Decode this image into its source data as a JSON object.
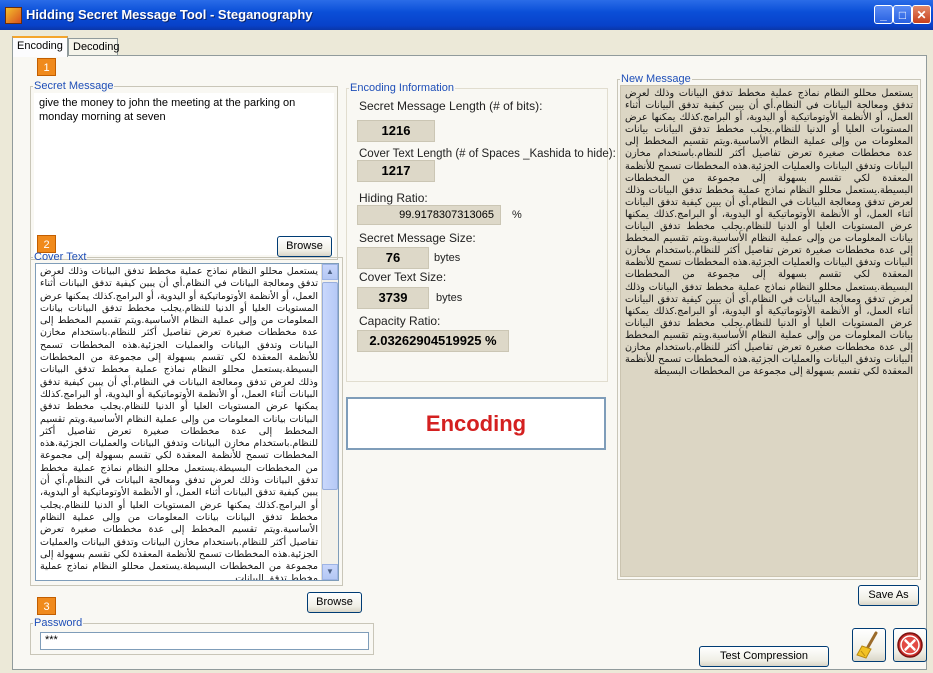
{
  "window": {
    "title": "Hidding Secret Message Tool - Steganography",
    "buttons": {
      "minimize": "_",
      "maximize": "□",
      "close": "✕"
    }
  },
  "tabs": [
    {
      "label": "Encoding",
      "active": true
    },
    {
      "label": "Decoding",
      "active": false
    }
  ],
  "steps": {
    "one": "1",
    "two": "2",
    "three": "3"
  },
  "secret_message": {
    "legend": "Secret Message",
    "text": "give the money to john the meeting at the parking on monday morning at seven"
  },
  "browse_label": "Browse",
  "cover_text": {
    "legend": "Cover Text",
    "text": "يستعمل محللو النظام نماذج عملية مخطط تدفق البيانات وذلك لعرض تدفق ومعالجة البيانات في النظام.أي أن يبين كيفية تدفق البيانات أثناء العمل، أو الأنظمة الأوتوماتيكية أو اليدوية، أو البرامج.كذلك يمكنها عرض المستويات العليا أو الدنيا للنظام.يجلب مخطط تدفق البيانات بيانات المعلومات من وإلى عملية النظام الأساسية.ويتم تقسيم المخطط إلى عدة مخططات صغيرة تعرض تفاصيل أكثر للنظام.باستخدام مخازن البيانات وتدفق البيانات والعمليات الجزئية.هذه المخططات تسمح للأنظمة المعقدة لكي تقسم بسهولة إلى مجموعة من المخططات البسيطة.يستعمل محللو النظام نماذج عملية مخطط تدفق البيانات وذلك لعرض تدفق ومعالجة البيانات في النظام.أي أن يبين كيفية تدفق البيانات أثناء العمل، أو الأنظمة الأوتوماتيكية أو اليدوية، أو البرامج.كذلك يمكنها عرض المستويات العليا أو الدنيا للنظام.يجلب مخطط تدفق البيانات بيانات المعلومات من وإلى عملية النظام الأساسية.ويتم تقسيم المخطط إلى عدة مخططات صغيرة تعرض تفاصيل أكثر للنظام.باستخدام مخازن البيانات وتدفق البيانات والعمليات الجزئية.هذه المخططات تسمح للأنظمة المعقدة لكي تقسم بسهولة إلى مجموعة من المخططات البسيطة.يستعمل محللو النظام نماذج عملية مخطط تدفق البيانات وذلك لعرض تدفق ومعالجة البيانات في النظام.أي أن يبين كيفية تدفق البيانات أثناء العمل، أو الأنظمة الأوتوماتيكية أو اليدوية، أو البرامج.كذلك يمكنها عرض المستويات العليا أو الدنيا للنظام.يجلب مخطط تدفق البيانات بيانات المعلومات من وإلى عملية النظام الأساسية.ويتم تقسيم المخطط إلى عدة مخططات صغيرة تعرض تفاصيل أكثر للنظام.باستخدام مخازن البيانات وتدفق البيانات والعمليات الجزئية.هذه المخططات تسمح للأنظمة المعقدة لكي تقسم بسهولة إلى مجموعة من المخططات البسيطة.يستعمل محللو النظام نماذج عملية مخطط تدفق البيانات"
  },
  "password": {
    "legend": "Password",
    "value": "***"
  },
  "encoding_info": {
    "legend": "Encoding Information",
    "secret_length_label": "Secret Message Length (# of bits):",
    "secret_length_value": "1216",
    "cover_length_label": "Cover Text Length (# of Spaces _Kashida to hide):",
    "cover_length_value": "1217",
    "hiding_ratio_label": "Hiding Ratio:",
    "hiding_ratio_value": "99.9178307313065",
    "percent": "%",
    "secret_size_label": "Secret Message Size:",
    "secret_size_value": "76",
    "cover_size_label": "Cover Text Size:",
    "cover_size_value": "3739",
    "bytes": "bytes",
    "capacity_label": "Capacity Ratio:",
    "capacity_value": "2.03262904519925 %"
  },
  "encoding_button": "Encoding",
  "new_message": {
    "legend": "New Message",
    "text": "يستعمل محللو النظام نماذج عملية مخطط تدفق البيانات وذلك لعرض تدفق ومعالجة البيانات في النظام.أي أن يبين كيفية تدفق البيانات أثناء العمل، أو الأنظمة الأوتوماتيكية أو اليدوية، أو البرامج.كذلك يمكنها عرض المستويات العليا أو الدنيا للنظام.يجلب مخطط تدفق البيانات بيانات المعلومات من وإلى عملية النظام الأساسية.ويتم تقسيم المخطط إلى عدة مخططات صغيرة تعرض تفاصيل أكثر للنظام.باستخدام مخازن البيانات وتدفق البيانات والعمليات الجزئية.هذه المخططات تسمح للأنظمة المعقدة لكي تقسم بسهولة إلى مجموعة من المخططات البسيطة.يستعمل محللو النظام نماذج عملية مخطط تدفق البيانات وذلك لعرض تدفق ومعالجة البيانات في النظام.أي أن يبين كيفية تدفق البيانات أثناء العمل، أو الأنظمة الأوتوماتيكية أو اليدوية، أو البرامج.كذلك يمكنها عرض المستويات العليا أو الدنيا للنظام.يجلب مخطط تدفق البيانات بيانات المعلومات من وإلى عملية النظام الأساسية.ويتم تقسيم المخطط إلى عدة مخططات صغيرة تعرض تفاصيل أكثر للنظام.باستخدام مخازن البيانات وتدفق البيانات والعمليات الجزئية.هذه المخططات تسمح للأنظمة المعقدة لكي تقسم بسهولة إلى مجموعة من المخططات البسيطة.يستعمل محللو النظام نماذج عملية مخطط تدفق البيانات وذلك لعرض تدفق ومعالجة البيانات في النظام.أي أن يبين كيفية تدفق البيانات أثناء العمل، أو الأنظمة الأوتوماتيكية أو اليدوية، أو البرامج.كذلك يمكنها عرض المستويات العليا أو الدنيا للنظام.يجلب مخطط تدفق البيانات بيانات المعلومات من وإلى عملية النظام الأساسية.ويتم تقسيم المخطط إلى عدة مخططات صغيرة تعرض تفاصيل أكثر للنظام.باستخدام مخازن البيانات وتدفق البيانات والعمليات الجزئية.هذه المخططات تسمح للأنظمة المعقدة لكي تقسم بسهولة إلى مجموعة من المخططات البسيطة"
  },
  "save_as_button": "Save As",
  "test_compression_button": "Test Compression",
  "icons": {
    "clear": "broom-icon",
    "exit": "exit-icon"
  },
  "colors": {
    "title_bar": "#0a4fd8",
    "encoding_text": "#d42020",
    "step_badge": "#f08a1c",
    "legend_text": "#1f4fb8"
  }
}
